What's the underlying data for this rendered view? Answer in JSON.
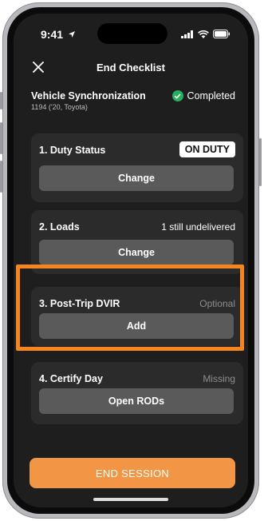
{
  "status_bar": {
    "time": "9:41"
  },
  "header": {
    "title": "End Checklist"
  },
  "sync": {
    "title": "Vehicle Synchronization",
    "subtitle": "1194 ('20, Toyota)",
    "status": "Completed"
  },
  "checklist": {
    "duty_status": {
      "title": "1. Duty Status",
      "badge": "ON DUTY",
      "button": "Change"
    },
    "loads": {
      "title": "2. Loads",
      "note": "1 still undelivered",
      "button": "Change"
    },
    "dvir": {
      "title": "3. Post-Trip DVIR",
      "note": "Optional",
      "button": "Add"
    },
    "certify": {
      "title": "4. Certify Day",
      "note": "Missing",
      "button": "Open RODs"
    }
  },
  "footer": {
    "end_button": "END SESSION"
  },
  "colors": {
    "accent": "#f5861f",
    "end_button": "#f29544",
    "success": "#27ae60"
  }
}
